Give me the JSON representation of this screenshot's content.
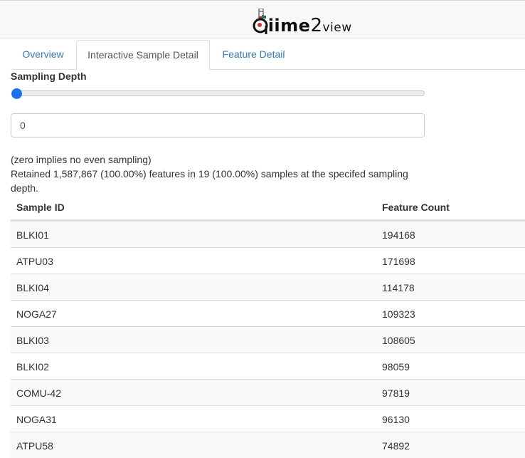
{
  "brand": {
    "name": "qiime2",
    "q": "q",
    "iime": "iime",
    "two": "2",
    "suffix": "view"
  },
  "tabs": [
    {
      "label": "Overview",
      "active": false
    },
    {
      "label": "Interactive Sample Detail",
      "active": true
    },
    {
      "label": "Feature Detail",
      "active": false
    }
  ],
  "sampling": {
    "label": "Sampling Depth",
    "slider_value": 0,
    "input_value": "0",
    "note_zero": "(zero implies no even sampling)",
    "note_retained": "Retained 1,587,867 (100.00%) features in 19 (100.00%) samples at the specifed sampling depth."
  },
  "table": {
    "columns": [
      "Sample ID",
      "Feature Count"
    ],
    "rows": [
      [
        "BLKI01",
        "194168"
      ],
      [
        "ATPU03",
        "171698"
      ],
      [
        "BLKI04",
        "114178"
      ],
      [
        "NOGA27",
        "109323"
      ],
      [
        "BLKI03",
        "108605"
      ],
      [
        "BLKI02",
        "98059"
      ],
      [
        "COMU-42",
        "97819"
      ],
      [
        "NOGA31",
        "96130"
      ],
      [
        "ATPU58",
        "74892"
      ]
    ]
  },
  "colors": {
    "link": "#337ab7",
    "slider_thumb": "#1a73e8",
    "stripe": "#f9f9f9"
  }
}
